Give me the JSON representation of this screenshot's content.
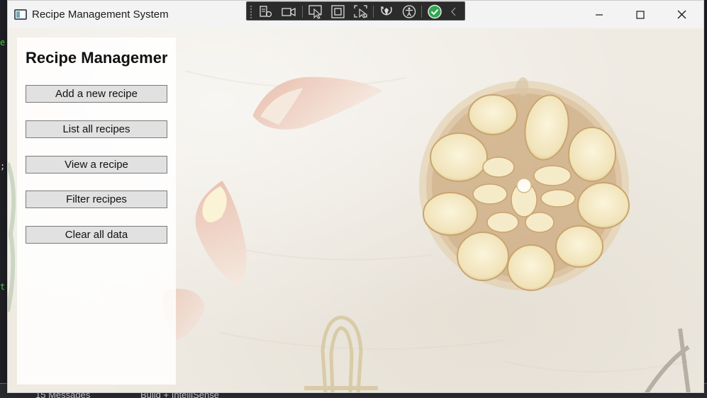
{
  "window": {
    "title": "Recipe Management System",
    "controls": [
      "minimize-icon",
      "maximize-icon",
      "close-icon"
    ]
  },
  "debug_toolbar": {
    "tools": [
      "live-visual-tree-icon",
      "record-icon",
      "select-element-icon",
      "display-layout-adorners-icon",
      "track-focus-icon",
      "hot-reload-icon",
      "accessibility-icon",
      "binding-check-icon",
      "collapse-icon"
    ]
  },
  "panel": {
    "title": "Recipe Managemer",
    "buttons": [
      {
        "label": "Add a new recipe"
      },
      {
        "label": "List all recipes"
      },
      {
        "label": "View a recipe"
      },
      {
        "label": "Filter recipes"
      },
      {
        "label": "Clear all data"
      }
    ]
  },
  "background_status": {
    "messages": "15 Messages",
    "build": "Build + IntelliSense"
  },
  "colors": {
    "window_bg": "#f3f0ea",
    "panel_bg": "#ffffff",
    "button_bg": "#e1e1e1",
    "button_border": "#7a7a7a",
    "debug_toolbar_bg": "#2b2b2b",
    "check_green": "#2fa84f"
  }
}
